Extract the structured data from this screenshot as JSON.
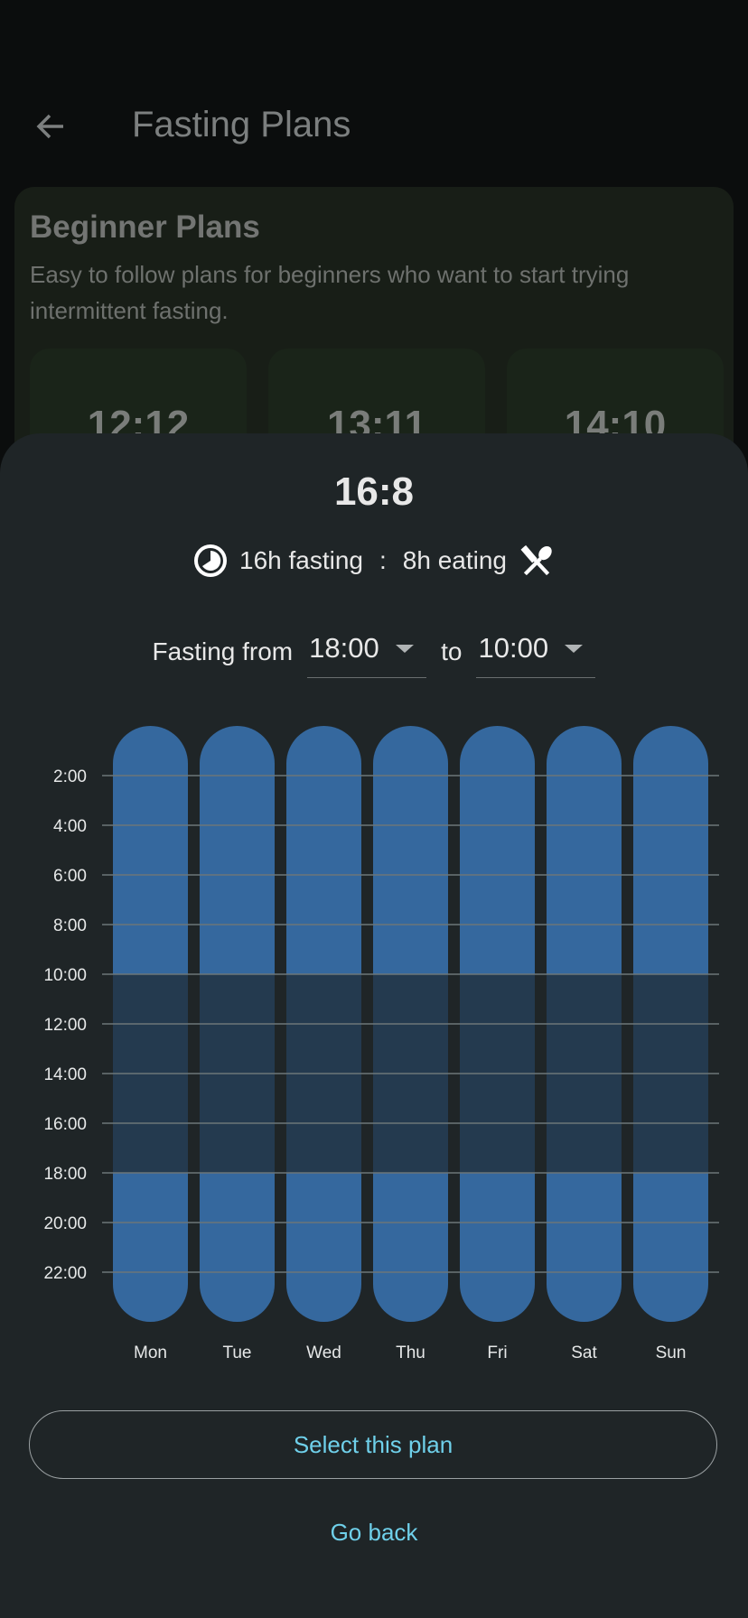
{
  "header": {
    "title": "Fasting Plans",
    "back_icon": "arrow-left-icon"
  },
  "background_card": {
    "title": "Beginner Plans",
    "description": "Easy to follow plans for beginners who want to start trying intermittent fasting.",
    "plans": [
      "12:12",
      "13:11",
      "14:10"
    ]
  },
  "sheet": {
    "plan_name": "16:8",
    "fasting_text": "16h fasting",
    "separator": ":",
    "eating_text": "8h eating",
    "fasting_icon": "clock-pie-icon",
    "eating_icon": "utensils-icon",
    "fasting_from_label": "Fasting from",
    "from_value": "18:00",
    "to_label": "to",
    "to_value": "10:00",
    "select_label": "Select this plan",
    "go_back_label": "Go back"
  },
  "colors": {
    "fasting": "#35689e",
    "eating": "#243a4f",
    "accent": "#6fd0ea"
  },
  "chart_data": {
    "type": "bar",
    "orientation": "vertical-timeline",
    "categories": [
      "Mon",
      "Tue",
      "Wed",
      "Thu",
      "Fri",
      "Sat",
      "Sun"
    ],
    "ylim": [
      0,
      24
    ],
    "y_ticks": [
      "2:00",
      "4:00",
      "6:00",
      "8:00",
      "10:00",
      "12:00",
      "14:00",
      "16:00",
      "18:00",
      "20:00",
      "22:00"
    ],
    "grid": true,
    "series": [
      {
        "segments": [
          {
            "type": "fasting",
            "from": 0,
            "to": 10
          },
          {
            "type": "eating",
            "from": 10,
            "to": 18
          },
          {
            "type": "fasting",
            "from": 18,
            "to": 24
          }
        ]
      }
    ]
  }
}
